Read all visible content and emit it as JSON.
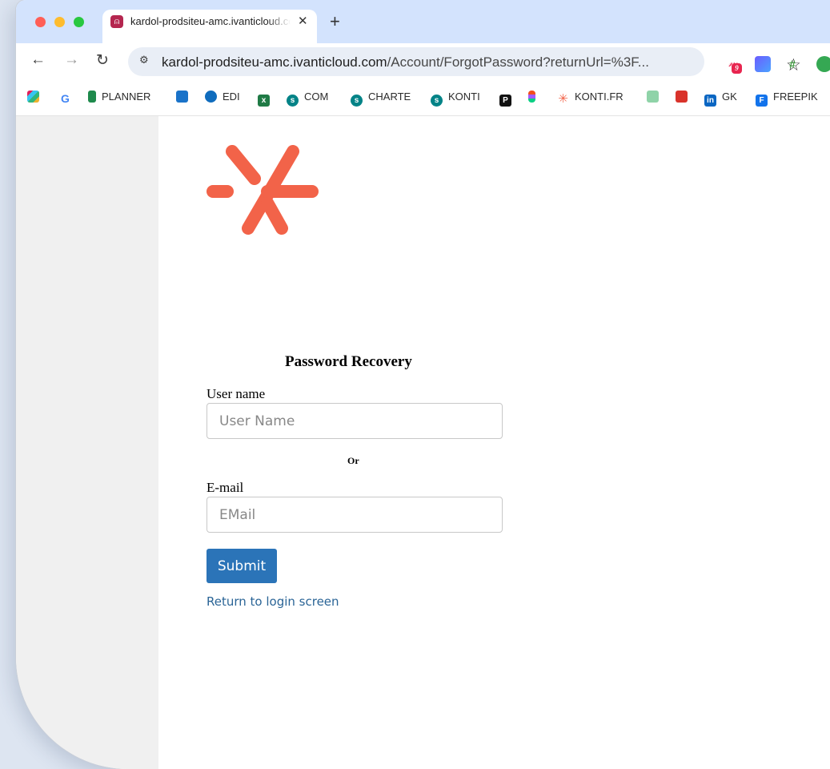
{
  "browser": {
    "tab": {
      "title": "kardol-prodsiteu-amc.ivanticloud.com",
      "close_glyph": "✕"
    },
    "new_tab_glyph": "+",
    "url": {
      "host": "kardol-prodsiteu-amc.ivanticloud.com",
      "path": "/Account/ForgotPassword?returnUrl=%3F..."
    },
    "bookmarks": [
      {
        "label": "",
        "icon": "slack-icon"
      },
      {
        "label": "G",
        "icon": "google-icon"
      },
      {
        "label": "PLANNER",
        "icon": "planner-icon"
      },
      {
        "label": "",
        "icon": "app-icon"
      },
      {
        "label": "EDI",
        "icon": "onedrive-icon"
      },
      {
        "label": "",
        "icon": "excel-icon"
      },
      {
        "label": "COM",
        "icon": "sharepoint-icon"
      },
      {
        "label": "CHARTE",
        "icon": "sharepoint-icon"
      },
      {
        "label": "KONTI",
        "icon": "sharepoint-icon"
      },
      {
        "label": "P",
        "icon": "p-icon"
      },
      {
        "label": "",
        "icon": "figma-icon"
      },
      {
        "label": "KONTI.FR",
        "icon": "konti-icon"
      },
      {
        "label": "",
        "icon": "download-icon"
      },
      {
        "label": "",
        "icon": "app-icon"
      },
      {
        "label": "GK",
        "icon": "linkedin-icon"
      },
      {
        "label": "FREEPIK",
        "icon": "freepik-icon"
      }
    ],
    "extension_badge": "9"
  },
  "page": {
    "title": "Password Recovery",
    "username": {
      "label": "User name",
      "placeholder": "User Name",
      "value": ""
    },
    "or_text": "Or",
    "email": {
      "label": "E-mail",
      "placeholder": "EMail",
      "value": ""
    },
    "submit_label": "Submit",
    "return_link": "Return to login screen",
    "accent_color": "#2b74b8",
    "logo_color": "#f26349"
  }
}
